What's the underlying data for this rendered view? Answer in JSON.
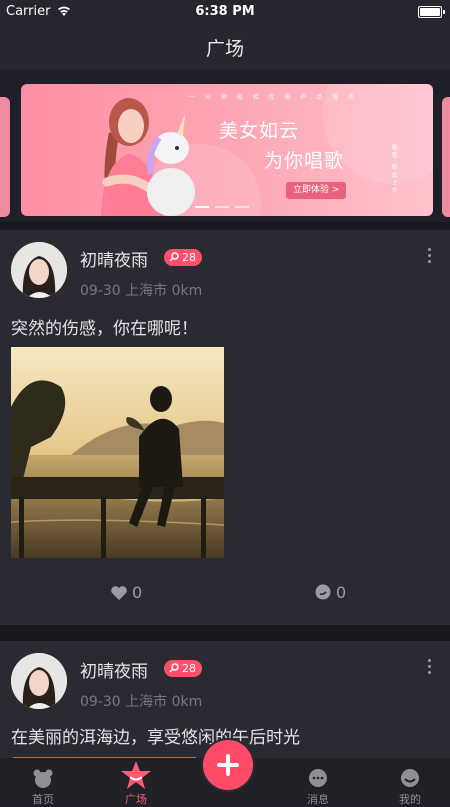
{
  "status_bar": {
    "carrier": "Carrier",
    "time": "6:38 PM"
  },
  "nav": {
    "title": "广场"
  },
  "banner": {
    "tagline": "一 分 钟 极 验 优 质 产 品 服 务",
    "headline_1": "美女如云",
    "headline_2": "为你唱歌",
    "cta_label": "立即体验 >",
    "vertical_text": "看 看 · 新 品 上 市"
  },
  "posts": [
    {
      "username": "初晴夜雨",
      "age_badge": "28",
      "date": "09-30",
      "location": "上海市",
      "distance": "0km",
      "content": "突然的伤感，你在哪呢！",
      "likes": "0",
      "comments": "0"
    },
    {
      "username": "初晴夜雨",
      "age_badge": "28",
      "date": "09-30",
      "location": "上海市",
      "distance": "0km",
      "content": "在美丽的洱海边，享受悠闲的午后时光"
    }
  ],
  "tabbar": {
    "items": [
      {
        "label": "首页",
        "icon": "bear-icon"
      },
      {
        "label": "广场",
        "icon": "star-icon",
        "active": true
      },
      {
        "label": "消息",
        "icon": "chat-icon"
      },
      {
        "label": "我的",
        "icon": "profile-icon"
      }
    ],
    "post_button_icon": "plus-icon"
  },
  "colors": {
    "accent": "#ff4f6a",
    "background": "#1f2027",
    "card": "#2a2b32",
    "banner_pink": "#ff8fa3"
  }
}
